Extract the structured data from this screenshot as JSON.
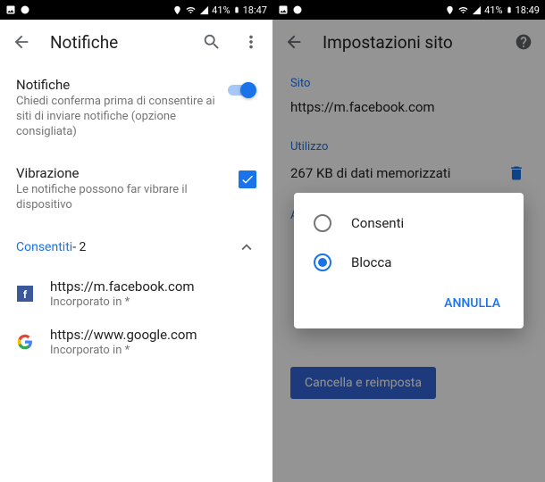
{
  "left": {
    "status": {
      "battery": "41%",
      "time": "18:47"
    },
    "title": "Notifiche",
    "notifications": {
      "title": "Notifiche",
      "sub": "Chiedi conferma prima di consentire ai siti di inviare notifiche (opzione consigliata)"
    },
    "vibration": {
      "title": "Vibrazione",
      "sub": "Le notifiche possono far vibrare il dispositivo"
    },
    "allowed": {
      "label": "Consentiti",
      "count": " - 2"
    },
    "sites": [
      {
        "url": "https://m.facebook.com",
        "sub": "Incorporato in *"
      },
      {
        "url": "https://www.google.com",
        "sub": "Incorporato in *"
      }
    ]
  },
  "right": {
    "status": {
      "battery": "41%",
      "time": "18:49"
    },
    "title": "Impostazioni sito",
    "site_label": "Sito",
    "site_url": "https://m.facebook.com",
    "usage_label": "Utilizzo",
    "usage_value": "267 KB di dati memorizzati",
    "dialog": {
      "opt_allow": "Consenti",
      "opt_block": "Blocca",
      "cancel": "ANNULLA"
    },
    "clear_btn": "Cancella e reimposta"
  }
}
